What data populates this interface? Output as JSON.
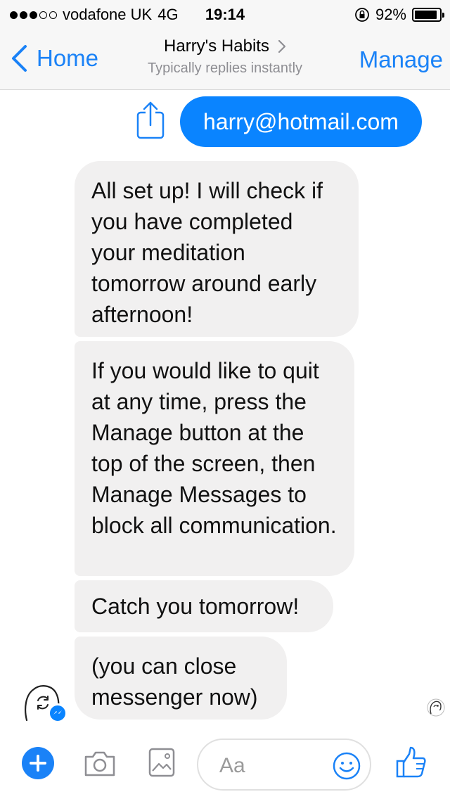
{
  "status_bar": {
    "carrier": "vodafone UK",
    "network": "4G",
    "time": "19:14",
    "battery": "92%",
    "battery_level": 0.92,
    "signal_bars_filled": 3,
    "signal_bars_total": 5
  },
  "nav": {
    "back_label": "Home",
    "title": "Harry's Habits",
    "subtitle": "Typically replies instantly",
    "manage_label": "Manage"
  },
  "messages": {
    "outgoing_email": "harry@hotmail.com",
    "incoming": [
      "All set up! I will check if you have completed your meditation tomorrow around early afternoon!",
      "If you would like to quit at any time, press the Manage button at the top of the screen, then Manage Messages to block all communication.",
      "Catch you tomorrow!",
      "(you can close messenger now)"
    ]
  },
  "composer": {
    "placeholder": "Aa"
  },
  "colors": {
    "accent": "#1a82f7",
    "outgoing_bubble": "#0a84ff",
    "incoming_bubble": "#f1f0f0"
  },
  "icons": [
    "share-icon",
    "camera-icon",
    "image-icon",
    "smile-icon",
    "like-icon",
    "plus-icon",
    "chevron-left-icon",
    "chevron-right-icon",
    "lock-rotation-icon",
    "battery-icon"
  ]
}
